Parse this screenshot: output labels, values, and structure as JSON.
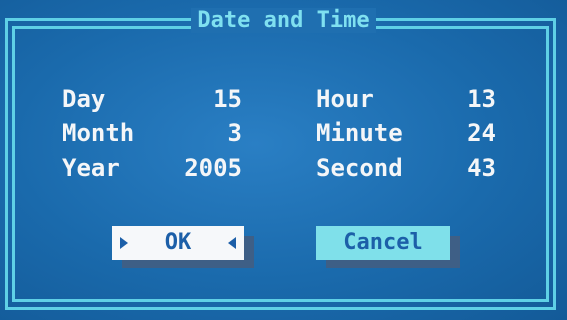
{
  "dialog": {
    "title": "Date and Time"
  },
  "fields": {
    "day": {
      "label": "Day",
      "value": "15"
    },
    "month": {
      "label": "Month",
      "value": "3"
    },
    "year": {
      "label": "Year",
      "value": "2005"
    },
    "hour": {
      "label": "Hour",
      "value": "13"
    },
    "minute": {
      "label": "Minute",
      "value": "24"
    },
    "second": {
      "label": "Second",
      "value": "43"
    }
  },
  "buttons": {
    "ok_label": "OK",
    "cancel_label": "Cancel"
  },
  "colors": {
    "background": "#1a6aac",
    "frame": "#5fd0e6",
    "text": "#f4f6f8",
    "ok_button": "#f6f8fa",
    "cancel_button": "#7fe0ea"
  }
}
